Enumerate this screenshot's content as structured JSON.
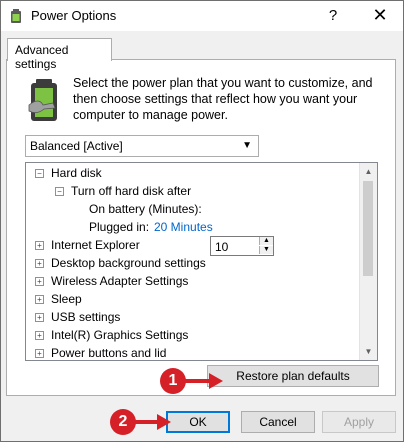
{
  "window": {
    "title": "Power Options",
    "help": "?",
    "close": "✕"
  },
  "tab": {
    "label": "Advanced settings"
  },
  "description": "Select the power plan that you want to customize, and then choose settings that reflect how you want your computer to manage power.",
  "plan": {
    "selected": "Balanced [Active]"
  },
  "tree": {
    "hard_disk": "Hard disk",
    "turn_off": "Turn off hard disk after",
    "on_battery_label": "On battery (Minutes):",
    "on_battery_value": "10",
    "plugged_label": "Plugged in:",
    "plugged_value": "20 Minutes",
    "items": [
      "Internet Explorer",
      "Desktop background settings",
      "Wireless Adapter Settings",
      "Sleep",
      "USB settings",
      "Intel(R) Graphics Settings",
      "Power buttons and lid"
    ]
  },
  "buttons": {
    "restore": "Restore plan defaults",
    "ok": "OK",
    "cancel": "Cancel",
    "apply": "Apply"
  },
  "annotations": {
    "step1": "1",
    "step2": "2",
    "color": "#d52027"
  }
}
